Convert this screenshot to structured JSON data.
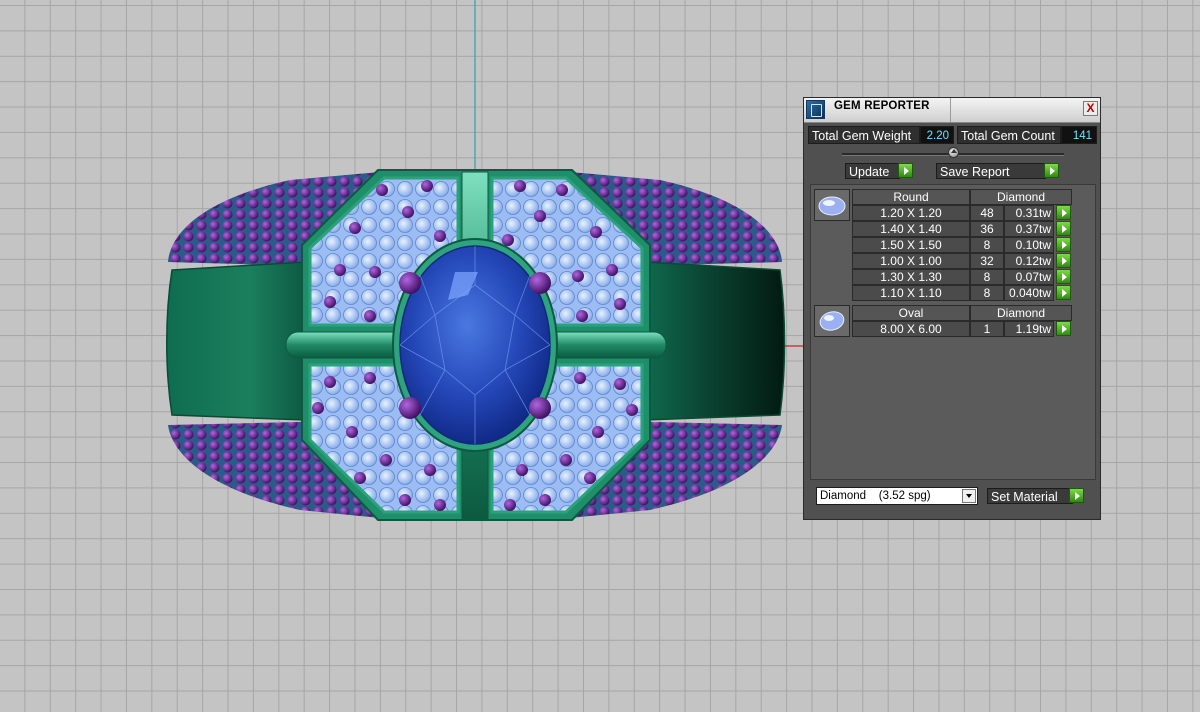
{
  "gem_reporter": {
    "title": "GEM REPORTER",
    "close_label": "X",
    "total_gem_weight_label": "Total Gem Weight",
    "total_gem_weight": "2.20",
    "total_gem_count_label": "Total Gem Count",
    "total_gem_count": "141",
    "update_label": "Update",
    "save_report_label": "Save Report",
    "groups": [
      {
        "icon": "round-gem-icon",
        "shape": "Round",
        "material": "Diamond",
        "rows": [
          {
            "size": "1.20 X 1.20",
            "count": "48",
            "weight": "0.31tw"
          },
          {
            "size": "1.40 X 1.40",
            "count": "36",
            "weight": "0.37tw"
          },
          {
            "size": "1.50 X 1.50",
            "count": "8",
            "weight": "0.10tw"
          },
          {
            "size": "1.00 X 1.00",
            "count": "32",
            "weight": "0.12tw"
          },
          {
            "size": "1.30 X 1.30",
            "count": "8",
            "weight": "0.07tw"
          },
          {
            "size": "1.10 X 1.10",
            "count": "8",
            "weight": "0.040tw"
          }
        ]
      },
      {
        "icon": "oval-gem-icon",
        "shape": "Oval",
        "material": "Diamond",
        "rows": [
          {
            "size": "8.00 X 6.00",
            "count": "1",
            "weight": "1.19tw"
          }
        ]
      }
    ],
    "material_select_value": "Diamond    (3.52 spg)",
    "set_material_label": "Set Material"
  },
  "viewport": {
    "background_color": "#c4c4c4",
    "grid_color": "#a6a6a6",
    "ring_metal_color": "#1e8f6a",
    "center_stone_color": "#2a52c8",
    "accent_stone_color": "#6a1e96",
    "pave_stone_color": "#a8c8f8",
    "axis_y_color": "#2aa6b0",
    "axis_x_color": "#d02020"
  }
}
